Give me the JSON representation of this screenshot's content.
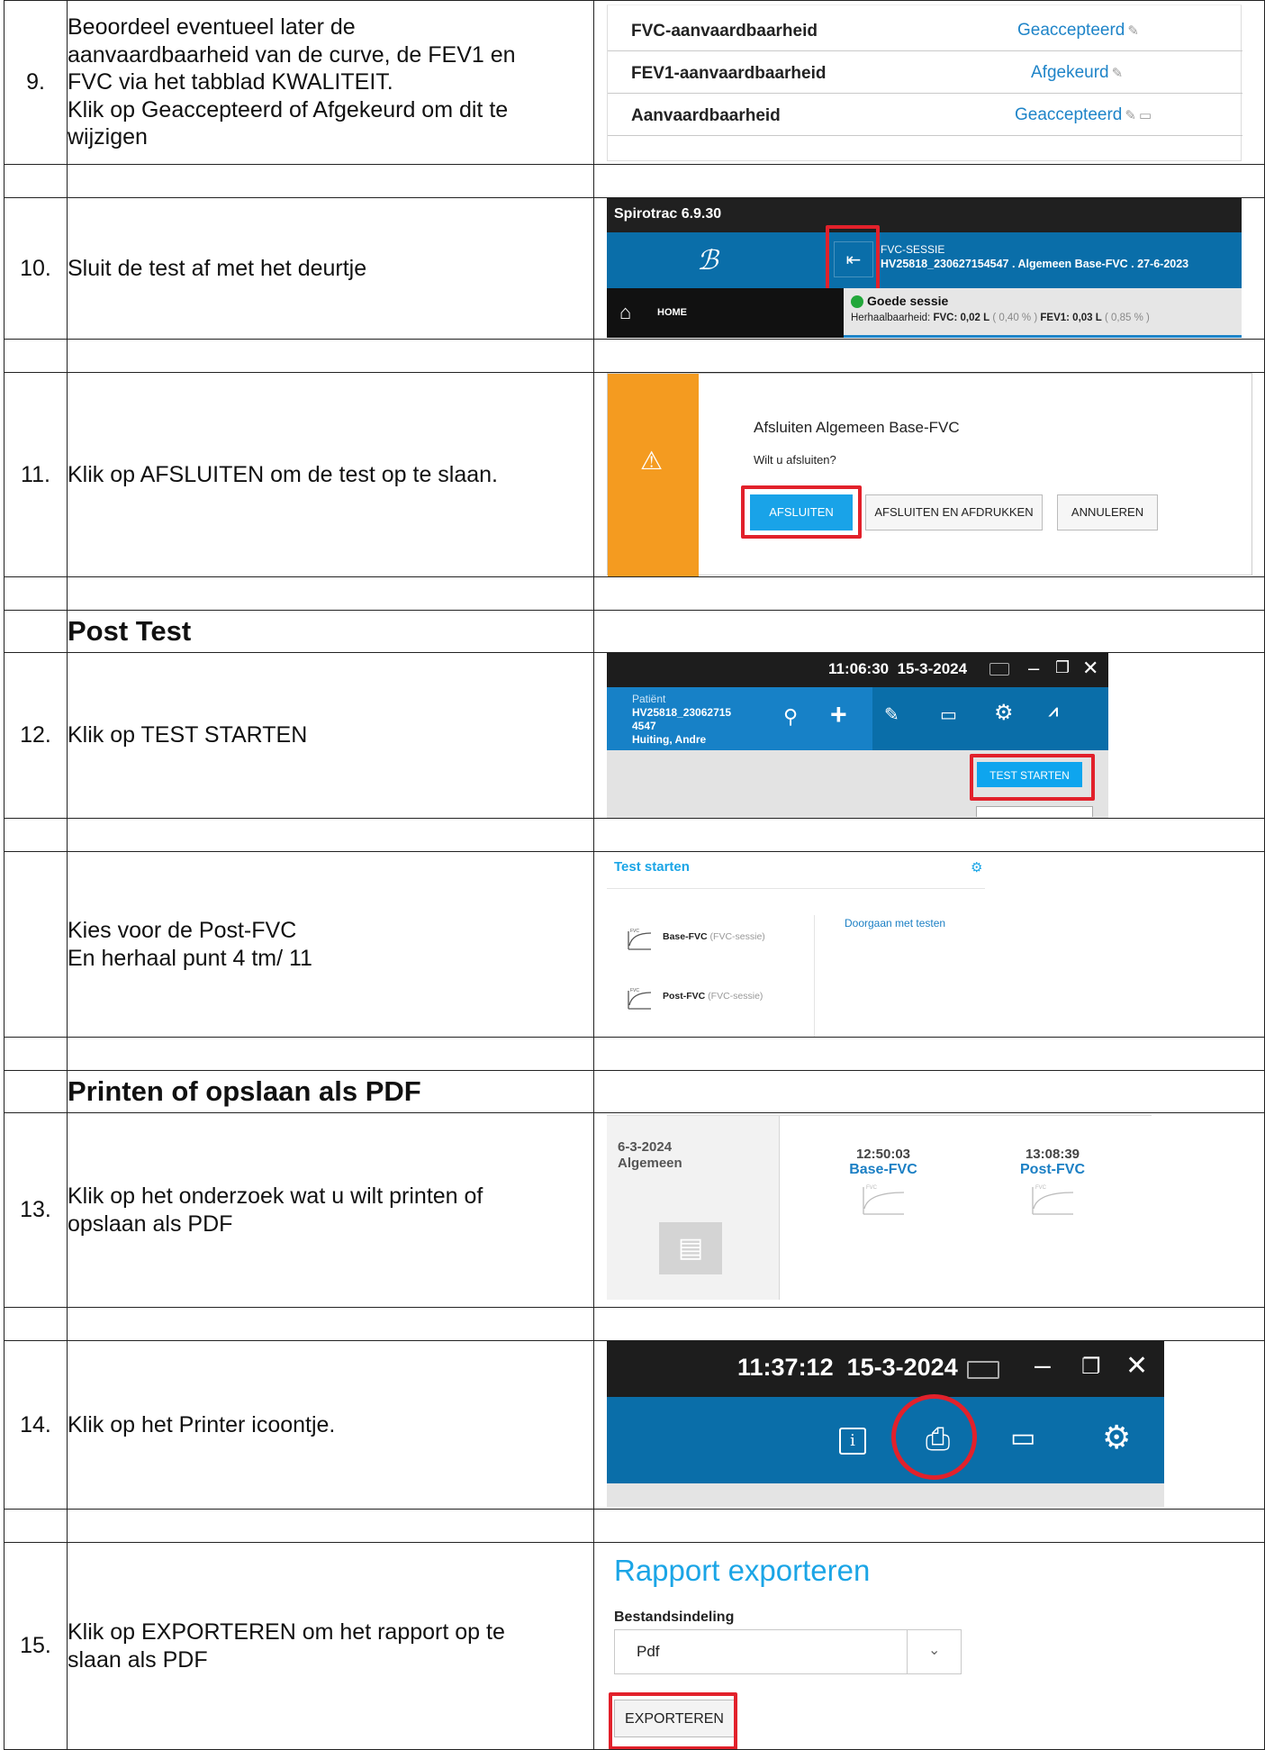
{
  "steps": [
    {
      "num": "9.",
      "lines": [
        "Beoordeel eventueel later de",
        "aanvaardbaarheid van de curve, de FEV1 en",
        "FVC via het tabblad KWALITEIT.",
        "Klik op Geaccepteerd of Afgekeurd om dit te",
        "wijzigen"
      ]
    },
    {
      "num": "10.",
      "lines": [
        "Sluit de test af met het deurtje"
      ]
    },
    {
      "num": "11.",
      "lines": [
        "Klik op AFSLUITEN om de test op te slaan."
      ]
    },
    {
      "num": "12.",
      "lines": [
        "Klik op TEST STARTEN"
      ]
    },
    {
      "num": "",
      "lines": [
        "Kies voor de Post-FVC",
        "En herhaal punt 4 tm/ 11"
      ]
    },
    {
      "num": "13.",
      "lines": [
        "Klik op het onderzoek wat u wilt printen of",
        "opslaan als PDF"
      ]
    },
    {
      "num": "14.",
      "lines": [
        "Klik op het Printer icoontje."
      ]
    },
    {
      "num": "15.",
      "lines": [
        "Klik op EXPORTEREN om het rapport op te",
        "slaan als PDF"
      ]
    }
  ],
  "headings": {
    "post_test": "Post Test",
    "print_pdf": "Printen of opslaan als PDF"
  },
  "shot9": {
    "rows": [
      {
        "label": "FVC-aanvaardbaarheid",
        "value": "Geaccepteerd"
      },
      {
        "label": "FEV1-aanvaardbaarheid",
        "value": "Afgekeurd"
      },
      {
        "label": "Aanvaardbaarheid",
        "value": "Geaccepteerd"
      }
    ]
  },
  "shot10": {
    "app_title": "Spirotrac 6.9.30",
    "session_label": "FVC-SESSIE",
    "session_id": "HV25818_230627154547 . Algemeen Base-FVC . 27-6-2023",
    "home": "HOME",
    "status": "Goede sessie",
    "repeat_prefix": "Herhaalbaarheid:",
    "fvc_label": "FVC:",
    "fvc_value": "0,02",
    "fvc_unit": "L",
    "fvc_pct": "( 0,40 % )",
    "fev1_label": "FEV1:",
    "fev1_value": "0,03",
    "fev1_unit": "L",
    "fev1_pct": "( 0,85 % )"
  },
  "shot11": {
    "title": "Afsluiten Algemeen Base-FVC",
    "question": "Wilt u afsluiten?",
    "btn_close": "AFSLUITEN",
    "btn_close_print": "AFSLUITEN EN AFDRUKKEN",
    "btn_cancel": "ANNULEREN"
  },
  "shot12": {
    "time": "11:06:30",
    "date": "15-3-2024",
    "patient_label": "Patiënt",
    "patient_id_1": "HV25818_23062715",
    "patient_id_2": "4547",
    "patient_name": "Huiting, Andre",
    "btn_start": "TEST STARTEN"
  },
  "shot12b": {
    "title": "Test starten",
    "option1": "Base-FVC",
    "option1_sub": "(FVC-sessie)",
    "option2": "Post-FVC",
    "option2_sub": "(FVC-sessie)",
    "continue": "Doorgaan met testen",
    "icon_label": "FVC"
  },
  "shot13": {
    "date": "6-3-2024",
    "category": "Algemeen",
    "t1_time": "12:50:03",
    "t1_name": "Base-FVC",
    "t2_time": "13:08:39",
    "t2_name": "Post-FVC",
    "icon_label": "FVC"
  },
  "shot14": {
    "time": "11:37:12",
    "date": "15-3-2024"
  },
  "shot15": {
    "title": "Rapport exporteren",
    "format_label": "Bestandsindeling",
    "format_value": "Pdf",
    "btn_export": "EXPORTEREN"
  },
  "colors": {
    "red": "#e2212b",
    "blue": "#0a6ea9",
    "link": "#1e84c8",
    "orange": "#f49b20",
    "cyan": "#0ea5ee"
  }
}
